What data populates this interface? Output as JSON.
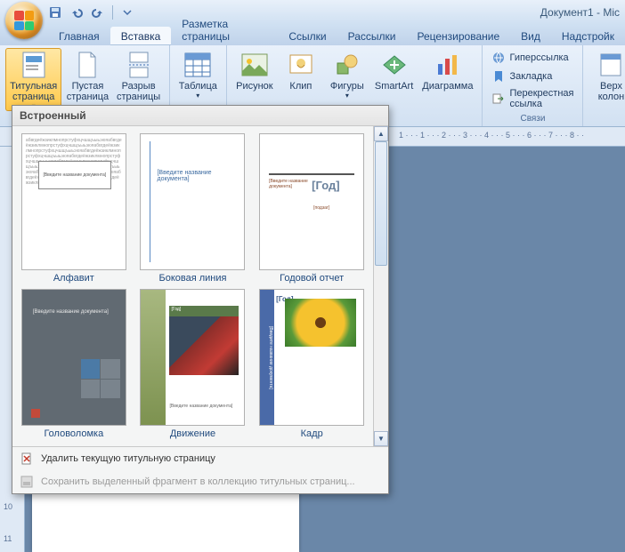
{
  "titlebar": {
    "doc_title": "Документ1 - Mic"
  },
  "qat": {
    "save": "save-icon",
    "undo": "undo-icon",
    "redo": "redo-icon"
  },
  "tabs": {
    "items": [
      {
        "label": "Главная"
      },
      {
        "label": "Вставка"
      },
      {
        "label": "Разметка страницы"
      },
      {
        "label": "Ссылки"
      },
      {
        "label": "Рассылки"
      },
      {
        "label": "Рецензирование"
      },
      {
        "label": "Вид"
      },
      {
        "label": "Надстройк"
      }
    ],
    "active_index": 1
  },
  "ribbon": {
    "pages": {
      "cover": "Титульная страница",
      "blank": "Пустая страница",
      "break": "Разрыв страницы"
    },
    "tables": {
      "table": "Таблица",
      "group_label": ""
    },
    "illustrations": {
      "picture": "Рисунок",
      "clip": "Клип",
      "shapes": "Фигуры",
      "smartart": "SmartArt",
      "chart": "Диаграмма"
    },
    "links": {
      "hyperlink": "Гиперссылка",
      "bookmark": "Закладка",
      "crossref": "Перекрестная ссылка",
      "group_label": "Связи"
    },
    "header": {
      "top": "Верх колон"
    }
  },
  "ruler": {
    "visible_marks": "1 · · · 1 · · · 2 · · · 3 · · · 4 · · · 5 · · · 6 · · · 7 · · · 8 · ·"
  },
  "left_ruler": {
    "marks": [
      "10",
      "11"
    ]
  },
  "gallery": {
    "header": "Встроенный",
    "items": [
      {
        "label": "Алфавит"
      },
      {
        "label": "Боковая линия"
      },
      {
        "label": "Годовой отчет"
      },
      {
        "label": "Головоломка"
      },
      {
        "label": "Движение"
      },
      {
        "label": "Кадр"
      }
    ],
    "thumb_text": {
      "alphabet_box": "[Введите название документа]",
      "sideline": "[Введите название документа]",
      "year_left": "[Введите название документа]",
      "year_god": "[Год]",
      "puzzle_title": "[Введите название документа]",
      "move_bar": "[Год]",
      "move_sub": "[Введите название документа]",
      "kadr_side": "[Введите название документа]",
      "kadr_god": "[Год]"
    },
    "footer": {
      "remove": "Удалить текущую титульную страницу",
      "save_selection": "Сохранить выделенный фрагмент в коллекцию титульных страниц..."
    }
  }
}
